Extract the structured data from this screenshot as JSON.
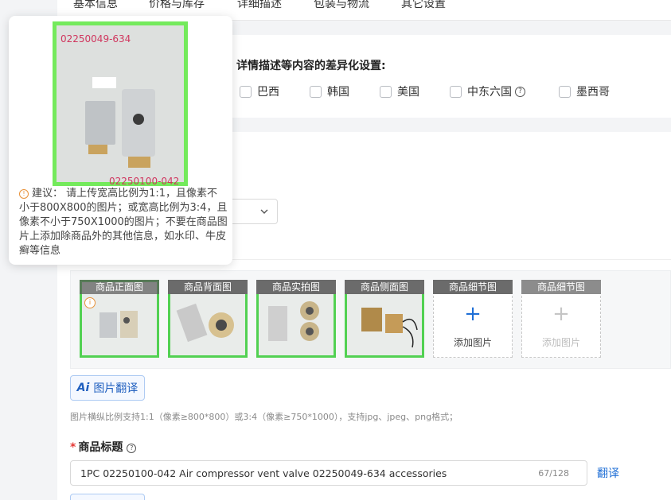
{
  "tabs": [
    "基本信息",
    "价格与库存",
    "详细描述",
    "包装与物流",
    "其它设置"
  ],
  "diff_settings": {
    "label": "详情描述等内容的差异化设置:",
    "countries": [
      "巴西",
      "韩国",
      "美国",
      "中东六国",
      "墨西哥"
    ]
  },
  "images": {
    "slots": [
      {
        "caption": "商品正面图"
      },
      {
        "caption": "商品背面图"
      },
      {
        "caption": "商品实拍图"
      },
      {
        "caption": "商品侧面图"
      },
      {
        "caption": "商品细节图",
        "add_label": "添加图片"
      },
      {
        "caption": "商品细节图",
        "add_label": "添加图片"
      }
    ],
    "translate_button": "图片翻译",
    "translate_ai": "Ai",
    "hint": "图片横纵比例支持1:1（像素≥800*800）或3:4（像素≥750*1000），支持jpg、jpeg、png格式；"
  },
  "product_title": {
    "required_mark": "*",
    "label": "商品标题",
    "value": "1PC 02250100-042 Air compressor vent valve 02250049-634 accessories",
    "count": "67/128",
    "translate_link": "翻译"
  },
  "tooltip": {
    "image_code_top": "02250049-634",
    "image_code_bottom": "02250100-042",
    "text": "建议：  请上传宽高比例为1:1，且像素不小于800X800的图片；或宽高比例为3:4，且像素不小于750X1000的图片；不要在商品图片上添加除商品外的其他信息，如水印、牛皮癣等信息"
  },
  "colors": {
    "accent": "#1f6fd6",
    "image_border": "#52d152",
    "required": "#e53935",
    "warning": "#e8923a"
  }
}
